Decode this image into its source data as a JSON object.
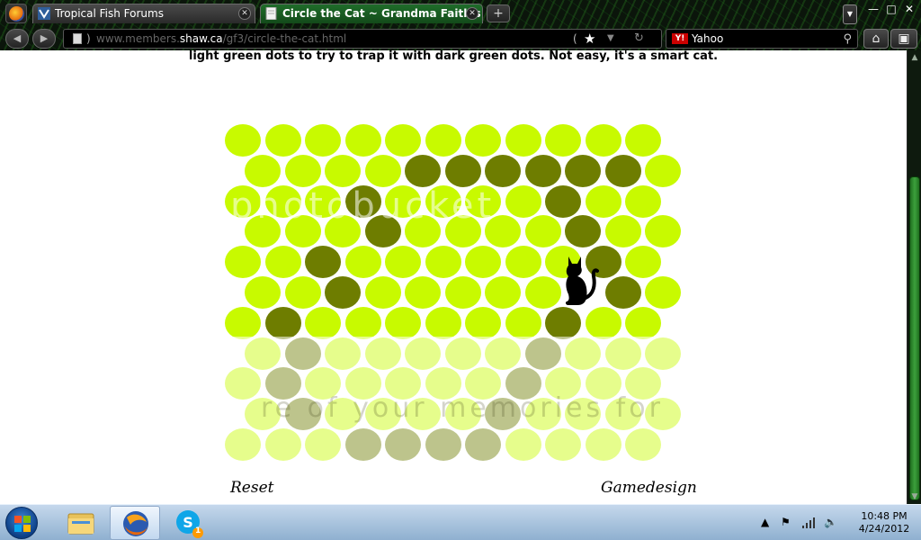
{
  "browser": {
    "tabs": [
      {
        "title": "Tropical Fish Forums",
        "active": false
      },
      {
        "title": "Circle the Cat ~ Grandma Faith's",
        "active": true
      }
    ],
    "url": {
      "prefix": "www.members.",
      "domain": "shaw.ca",
      "path": "/gf3/circle-the-cat.html"
    },
    "search_engine": "Yahoo",
    "new_tab_symbol": "+",
    "list_all_symbol": "▼",
    "window_buttons": {
      "minimize": "—",
      "restore": "□",
      "close": "✕"
    }
  },
  "page": {
    "intro_text": "light green dots to try to trap it with dark green dots. Not easy, it's a smart cat.",
    "reset_label": "Reset",
    "gamedesign_label": "Gamedesign",
    "watermark_text": "photobucket",
    "watermark_text2": "re of your memories for",
    "board": {
      "rows": 11,
      "cols": 11,
      "cat_position": {
        "row": 5,
        "col": 8
      },
      "dark_dots": [
        [
          1,
          4
        ],
        [
          1,
          5
        ],
        [
          1,
          6
        ],
        [
          1,
          7
        ],
        [
          1,
          8
        ],
        [
          1,
          9
        ],
        [
          2,
          3
        ],
        [
          2,
          8
        ],
        [
          3,
          3
        ],
        [
          3,
          8
        ],
        [
          4,
          2
        ],
        [
          4,
          9
        ],
        [
          5,
          2
        ],
        [
          5,
          9
        ],
        [
          6,
          1
        ],
        [
          6,
          8
        ],
        [
          7,
          1
        ],
        [
          7,
          7
        ],
        [
          8,
          1
        ],
        [
          8,
          7
        ],
        [
          9,
          1
        ],
        [
          9,
          6
        ],
        [
          10,
          3
        ],
        [
          10,
          4
        ],
        [
          10,
          5
        ],
        [
          10,
          6
        ]
      ],
      "colors": {
        "light": "#c8fa00",
        "dark": "#6e7d00",
        "cat": "#000000"
      }
    }
  },
  "taskbar": {
    "items": [
      {
        "name": "explorer",
        "icon": "folder-icon"
      },
      {
        "name": "firefox",
        "icon": "firefox-icon",
        "active": true
      },
      {
        "name": "skype",
        "icon": "skype-icon",
        "badge": "1"
      }
    ],
    "time": "10:48 PM",
    "date": "4/24/2012"
  }
}
